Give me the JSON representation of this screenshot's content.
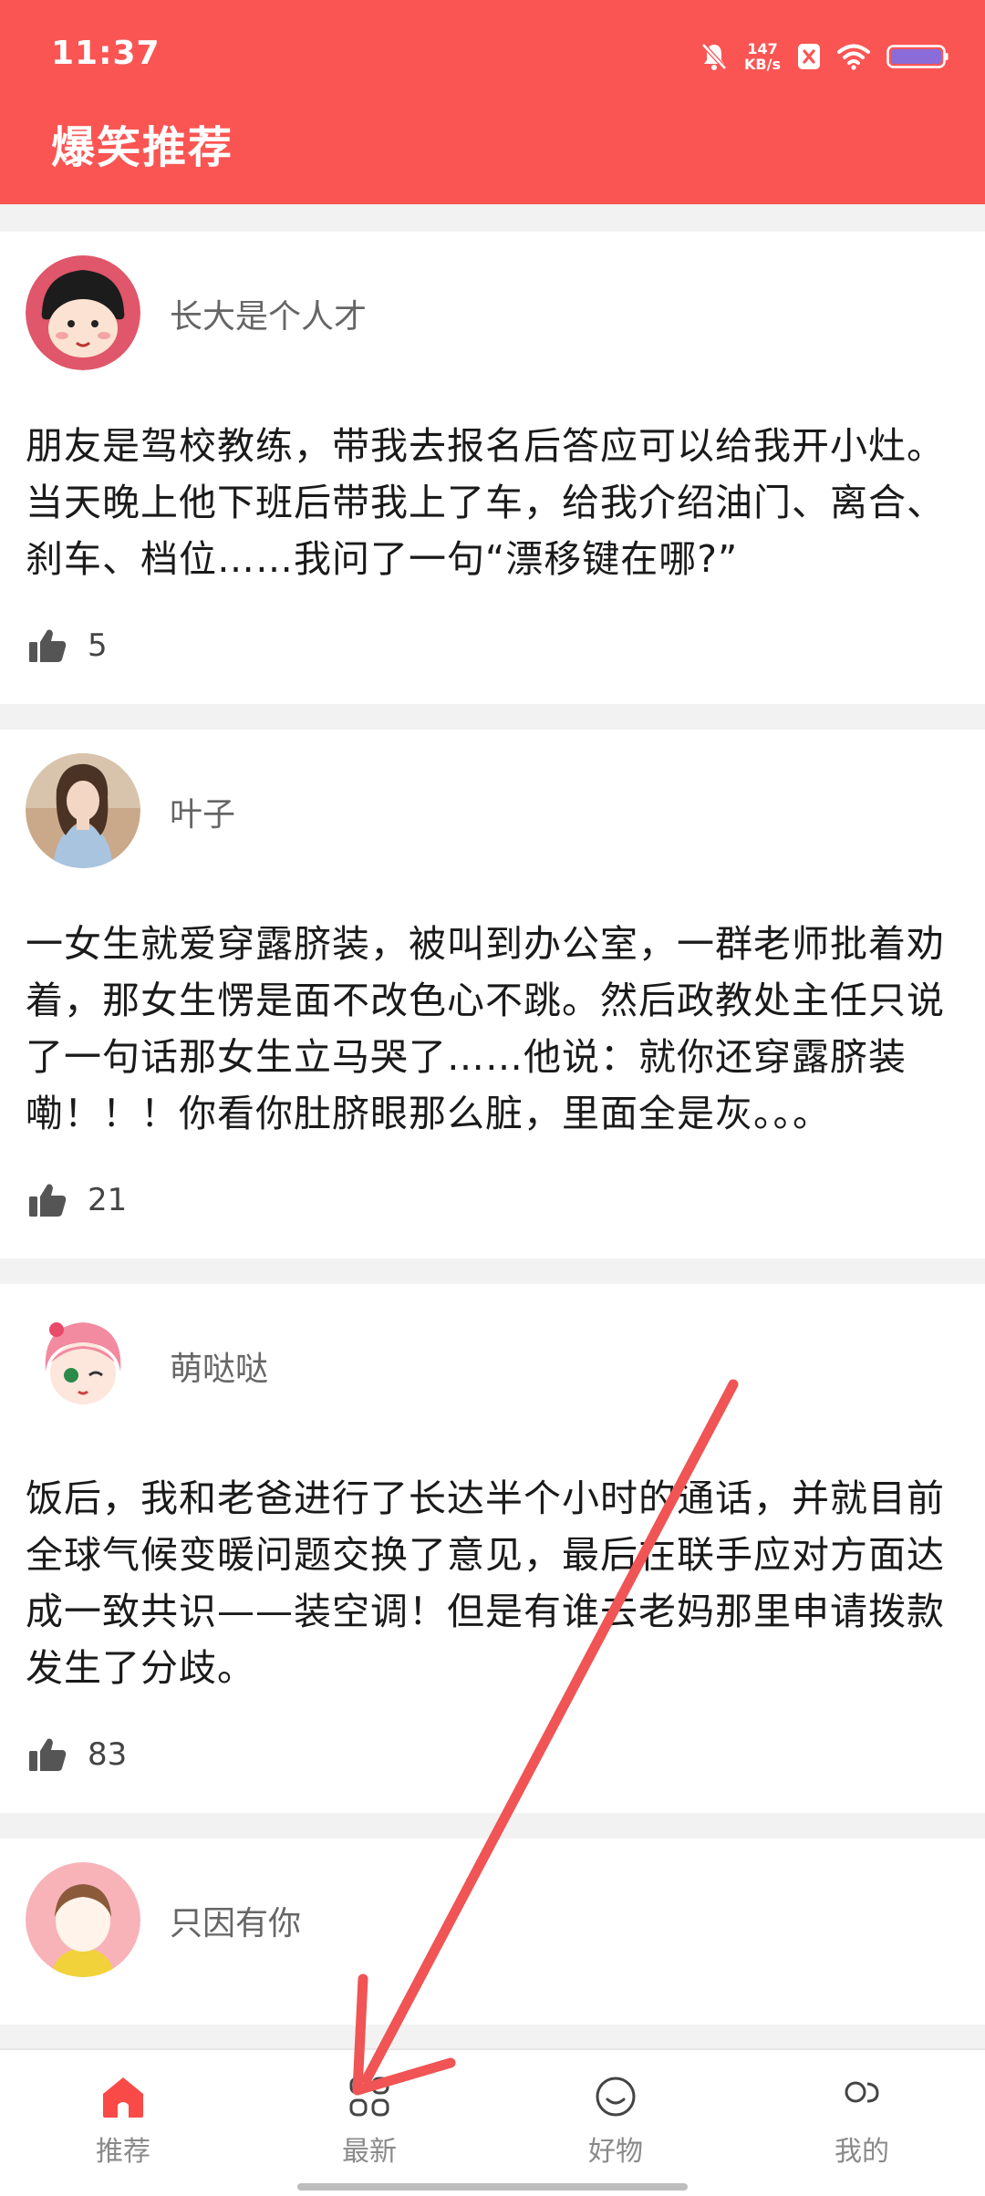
{
  "status_bar": {
    "time": "11:37",
    "net_speed_value": "147",
    "net_speed_unit": "KB/s"
  },
  "header": {
    "title": "爆笑推荐"
  },
  "posts": [
    {
      "username": "长大是个人才",
      "text": "朋友是驾校教练，带我去报名后答应可以给我开小灶。当天晚上他下班后带我上了车，给我介绍油门、离合、刹车、档位……我问了一句“漂移键在哪?”",
      "likes": "5"
    },
    {
      "username": "叶子",
      "text": "一女生就爱穿露脐装，被叫到办公室，一群老师批着劝着，那女生愣是面不改色心不跳。然后政教处主任只说了一句话那女生立马哭了……他说：就你还穿露脐装嘞！！！你看你肚脐眼那么脏，里面全是灰。。。",
      "likes": "21"
    },
    {
      "username": "萌哒哒",
      "text": "饭后，我和老爸进行了长达半个小时的通话，并就目前全球气候变暖问题交换了意见，最后在联手应对方面达成一致共识——装空调！但是有谁去老妈那里申请拨款发生了分歧。",
      "likes": "83"
    },
    {
      "username": "只因有你"
    }
  ],
  "bottom_nav": {
    "items": [
      {
        "label": "推荐",
        "icon": "home-icon",
        "active": true
      },
      {
        "label": "最新",
        "icon": "grid-icon",
        "active": false
      },
      {
        "label": "好物",
        "icon": "smile-icon",
        "active": false
      },
      {
        "label": "我的",
        "icon": "profile-icon",
        "active": false
      }
    ]
  },
  "colors": {
    "accent": "#fa5553",
    "annotation_arrow": "#f05454"
  }
}
